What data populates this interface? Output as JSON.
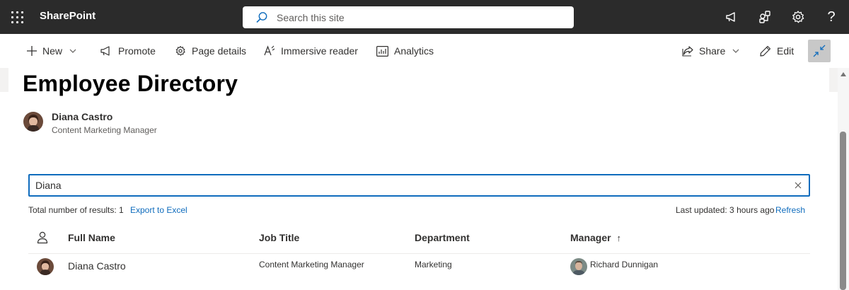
{
  "suitebar": {
    "brand": "SharePoint",
    "search_placeholder": "Search this site",
    "icons": [
      "waffle-icon",
      "megaphone-icon",
      "sharepoint-app-icon",
      "gear-icon",
      "help-icon"
    ],
    "background": "#2b2b2b"
  },
  "commandbar": {
    "new_label": "New",
    "promote_label": "Promote",
    "page_details_label": "Page details",
    "immersive_reader_label": "Immersive reader",
    "analytics_label": "Analytics",
    "share_label": "Share",
    "edit_label": "Edit"
  },
  "page": {
    "title": "Employee Directory",
    "author": {
      "name": "Diana Castro",
      "title": "Content Marketing Manager"
    }
  },
  "directory": {
    "search_value": "Diana",
    "results_label": "Total number of results: 1",
    "export_label": "Export to Excel",
    "last_updated": "Last updated: 3 hours ago",
    "refresh_label": "Refresh",
    "columns": {
      "full_name": "Full Name",
      "job_title": "Job Title",
      "department": "Department",
      "manager": "Manager",
      "manager_sort": "↑"
    },
    "rows": [
      {
        "full_name": "Diana Castro",
        "job_title": "Content Marketing Manager",
        "department": "Marketing",
        "manager": "Richard Dunnigan"
      }
    ]
  },
  "colors": {
    "accent": "#0f6cbd",
    "text": "#323130"
  }
}
